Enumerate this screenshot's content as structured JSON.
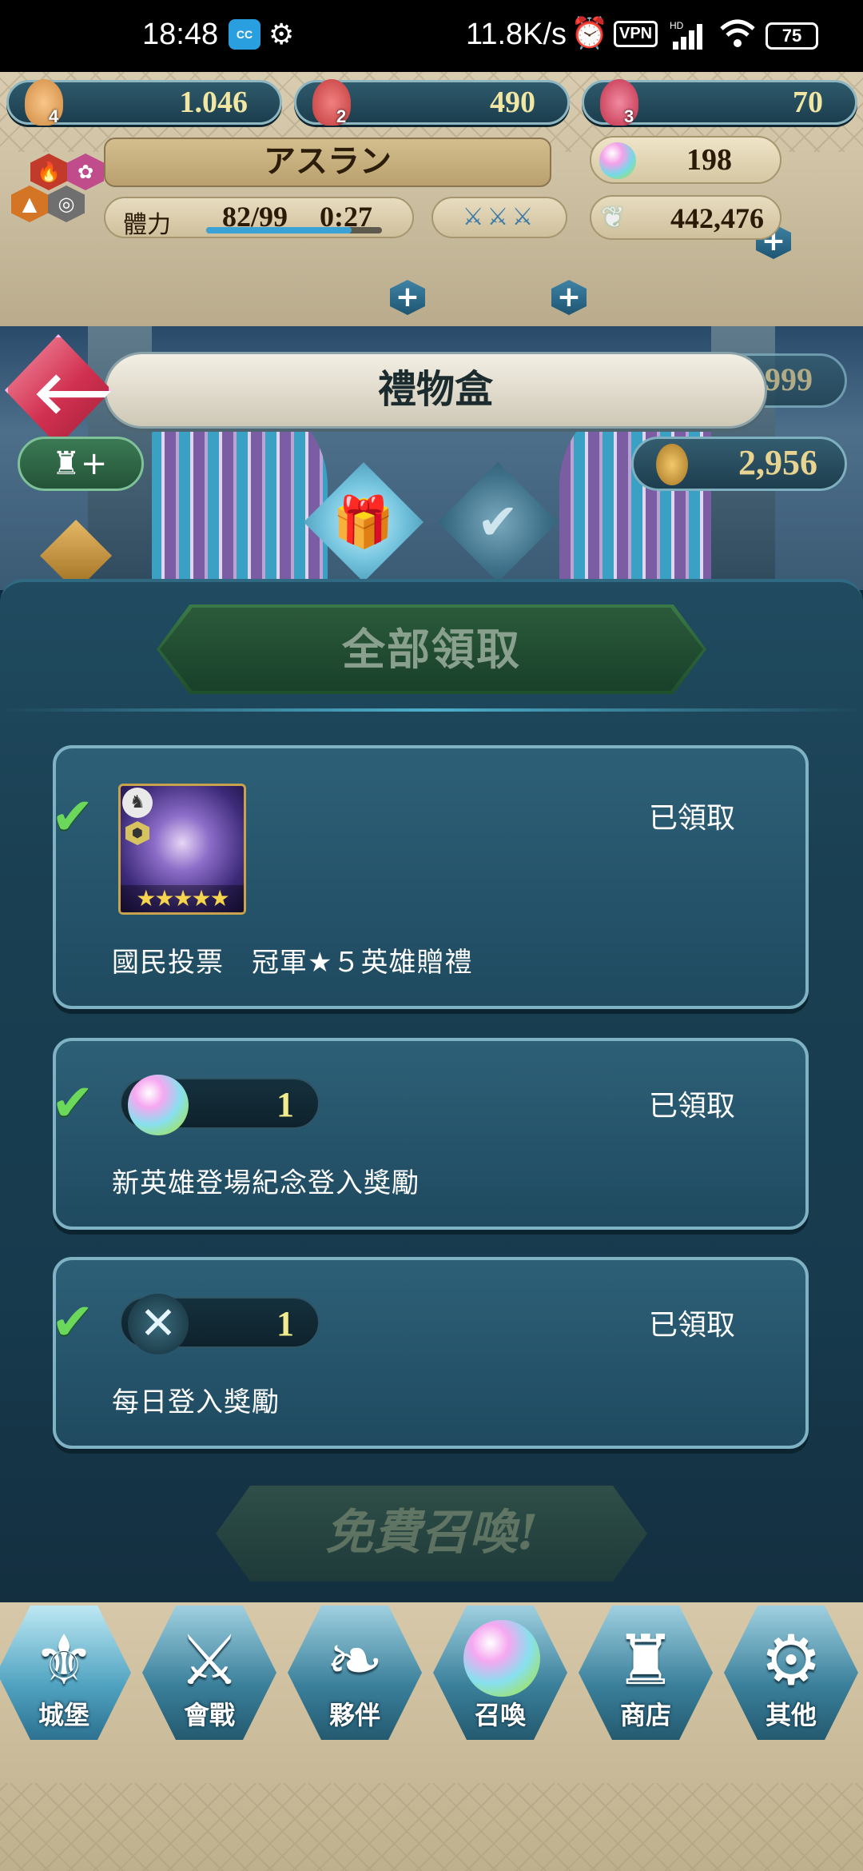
{
  "status_bar": {
    "time": "18:48",
    "app_badge": "CC",
    "net_speed": "11.8K/s",
    "vpn": "VPN",
    "network": "HD",
    "battery": "75"
  },
  "currencies": [
    {
      "badge": "4",
      "value": "1.046",
      "color": "#d28a40"
    },
    {
      "badge": "2",
      "value": "490",
      "color": "#c23b3b"
    },
    {
      "badge": "3",
      "value": "70",
      "color": "#c2304a"
    }
  ],
  "player": {
    "name": "アスラン",
    "orbs": "198",
    "stamina_label": "體力",
    "stamina_value": "82/99",
    "stamina_timer": "0:27",
    "stamina_fraction": 0.828,
    "feathers": "442,476"
  },
  "screen": {
    "title": "禮物盒",
    "back_icon": "back-arrow-icon",
    "partial_value": "999",
    "medal_value": "2,956"
  },
  "tabs": [
    {
      "name": "gift-box-icon",
      "active": true
    },
    {
      "name": "received-icon",
      "active": false
    }
  ],
  "claim_all_label": "全部領取",
  "gifts": [
    {
      "type": "hero",
      "status": "已領取",
      "description": "國民投票　冠軍★５英雄贈禮",
      "stars": "★★★★★"
    },
    {
      "type": "orb",
      "quantity": "1",
      "status": "已領取",
      "description": "新英雄登場紀念登入獎勵"
    },
    {
      "type": "dueling-sword",
      "quantity": "1",
      "status": "已領取",
      "description": "每日登入獎勵"
    }
  ],
  "free_summon_label": "免費召喚!",
  "nav": [
    {
      "label": "城堡",
      "icon": "castle-emblem-icon",
      "active": true
    },
    {
      "label": "會戰",
      "icon": "crossed-swords-icon",
      "active": false
    },
    {
      "label": "夥伴",
      "icon": "wings-icon",
      "active": false
    },
    {
      "label": "召喚",
      "icon": "orb-icon",
      "active": false
    },
    {
      "label": "商店",
      "icon": "shop-castle-icon",
      "active": false
    },
    {
      "label": "其他",
      "icon": "gear-icon",
      "active": false
    }
  ]
}
